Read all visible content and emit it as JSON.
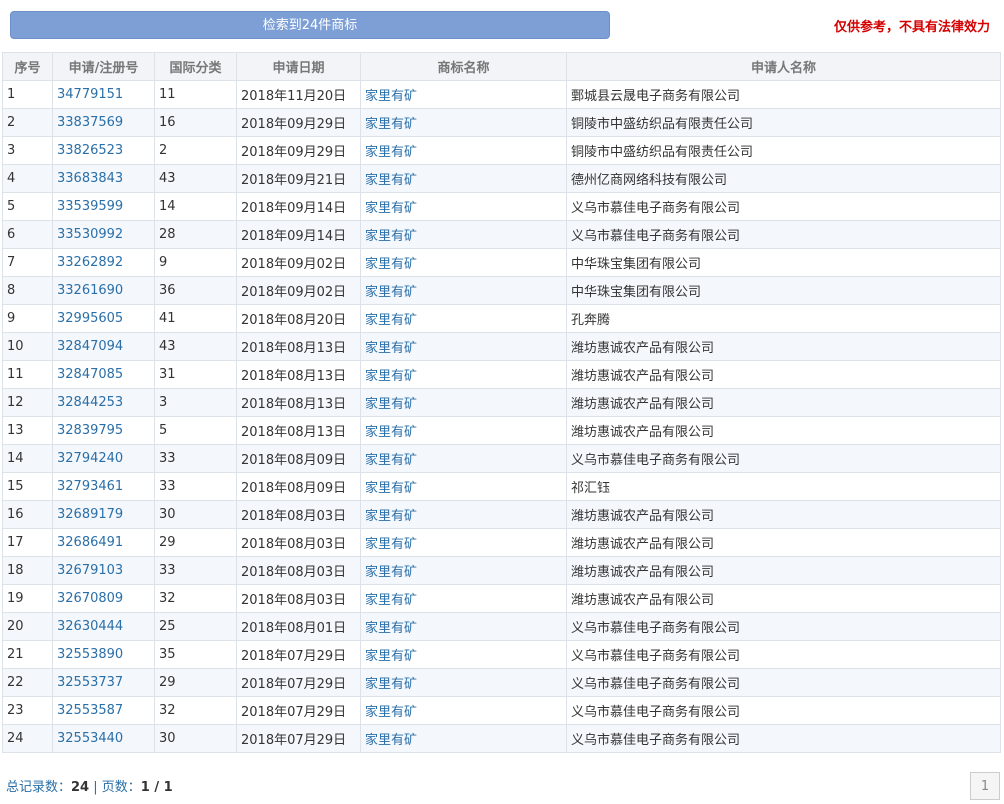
{
  "header": {
    "result_label": "检索到24件商标",
    "disclaimer": "仅供参考，不具有法律效力"
  },
  "table": {
    "columns": [
      "序号",
      "申请/注册号",
      "国际分类",
      "申请日期",
      "商标名称",
      "申请人名称"
    ],
    "rows": [
      [
        "1",
        "34779151",
        "11",
        "2018年11月20日",
        "家里有矿",
        "鄄城县云晟电子商务有限公司"
      ],
      [
        "2",
        "33837569",
        "16",
        "2018年09月29日",
        "家里有矿",
        "铜陵市中盛纺织品有限责任公司"
      ],
      [
        "3",
        "33826523",
        "2",
        "2018年09月29日",
        "家里有矿",
        "铜陵市中盛纺织品有限责任公司"
      ],
      [
        "4",
        "33683843",
        "43",
        "2018年09月21日",
        "家里有矿",
        "德州亿商网络科技有限公司"
      ],
      [
        "5",
        "33539599",
        "14",
        "2018年09月14日",
        "家里有矿",
        "义乌市慕佳电子商务有限公司"
      ],
      [
        "6",
        "33530992",
        "28",
        "2018年09月14日",
        "家里有矿",
        "义乌市慕佳电子商务有限公司"
      ],
      [
        "7",
        "33262892",
        "9",
        "2018年09月02日",
        "家里有矿",
        "中华珠宝集团有限公司"
      ],
      [
        "8",
        "33261690",
        "36",
        "2018年09月02日",
        "家里有矿",
        "中华珠宝集团有限公司"
      ],
      [
        "9",
        "32995605",
        "41",
        "2018年08月20日",
        "家里有矿",
        "孔奔腾"
      ],
      [
        "10",
        "32847094",
        "43",
        "2018年08月13日",
        "家里有矿",
        "潍坊惠诚农产品有限公司"
      ],
      [
        "11",
        "32847085",
        "31",
        "2018年08月13日",
        "家里有矿",
        "潍坊惠诚农产品有限公司"
      ],
      [
        "12",
        "32844253",
        "3",
        "2018年08月13日",
        "家里有矿",
        "潍坊惠诚农产品有限公司"
      ],
      [
        "13",
        "32839795",
        "5",
        "2018年08月13日",
        "家里有矿",
        "潍坊惠诚农产品有限公司"
      ],
      [
        "14",
        "32794240",
        "33",
        "2018年08月09日",
        "家里有矿",
        "义乌市慕佳电子商务有限公司"
      ],
      [
        "15",
        "32793461",
        "33",
        "2018年08月09日",
        "家里有矿",
        "祁汇钰"
      ],
      [
        "16",
        "32689179",
        "30",
        "2018年08月03日",
        "家里有矿",
        "潍坊惠诚农产品有限公司"
      ],
      [
        "17",
        "32686491",
        "29",
        "2018年08月03日",
        "家里有矿",
        "潍坊惠诚农产品有限公司"
      ],
      [
        "18",
        "32679103",
        "33",
        "2018年08月03日",
        "家里有矿",
        "潍坊惠诚农产品有限公司"
      ],
      [
        "19",
        "32670809",
        "32",
        "2018年08月03日",
        "家里有矿",
        "潍坊惠诚农产品有限公司"
      ],
      [
        "20",
        "32630444",
        "25",
        "2018年08月01日",
        "家里有矿",
        "义乌市慕佳电子商务有限公司"
      ],
      [
        "21",
        "32553890",
        "35",
        "2018年07月29日",
        "家里有矿",
        "义乌市慕佳电子商务有限公司"
      ],
      [
        "22",
        "32553737",
        "29",
        "2018年07月29日",
        "家里有矿",
        "义乌市慕佳电子商务有限公司"
      ],
      [
        "23",
        "32553587",
        "32",
        "2018年07月29日",
        "家里有矿",
        "义乌市慕佳电子商务有限公司"
      ],
      [
        "24",
        "32553440",
        "30",
        "2018年07月29日",
        "家里有矿",
        "义乌市慕佳电子商务有限公司"
      ]
    ]
  },
  "footer": {
    "total_label": "总记录数：",
    "total_value": "24",
    "separator": " | ",
    "pages_label": "页数：",
    "pages_value": "1 / 1",
    "page_button": "1"
  },
  "colors": {
    "accent": "#7d9fd6",
    "link": "#2a6fa8",
    "warning": "#d40000"
  }
}
